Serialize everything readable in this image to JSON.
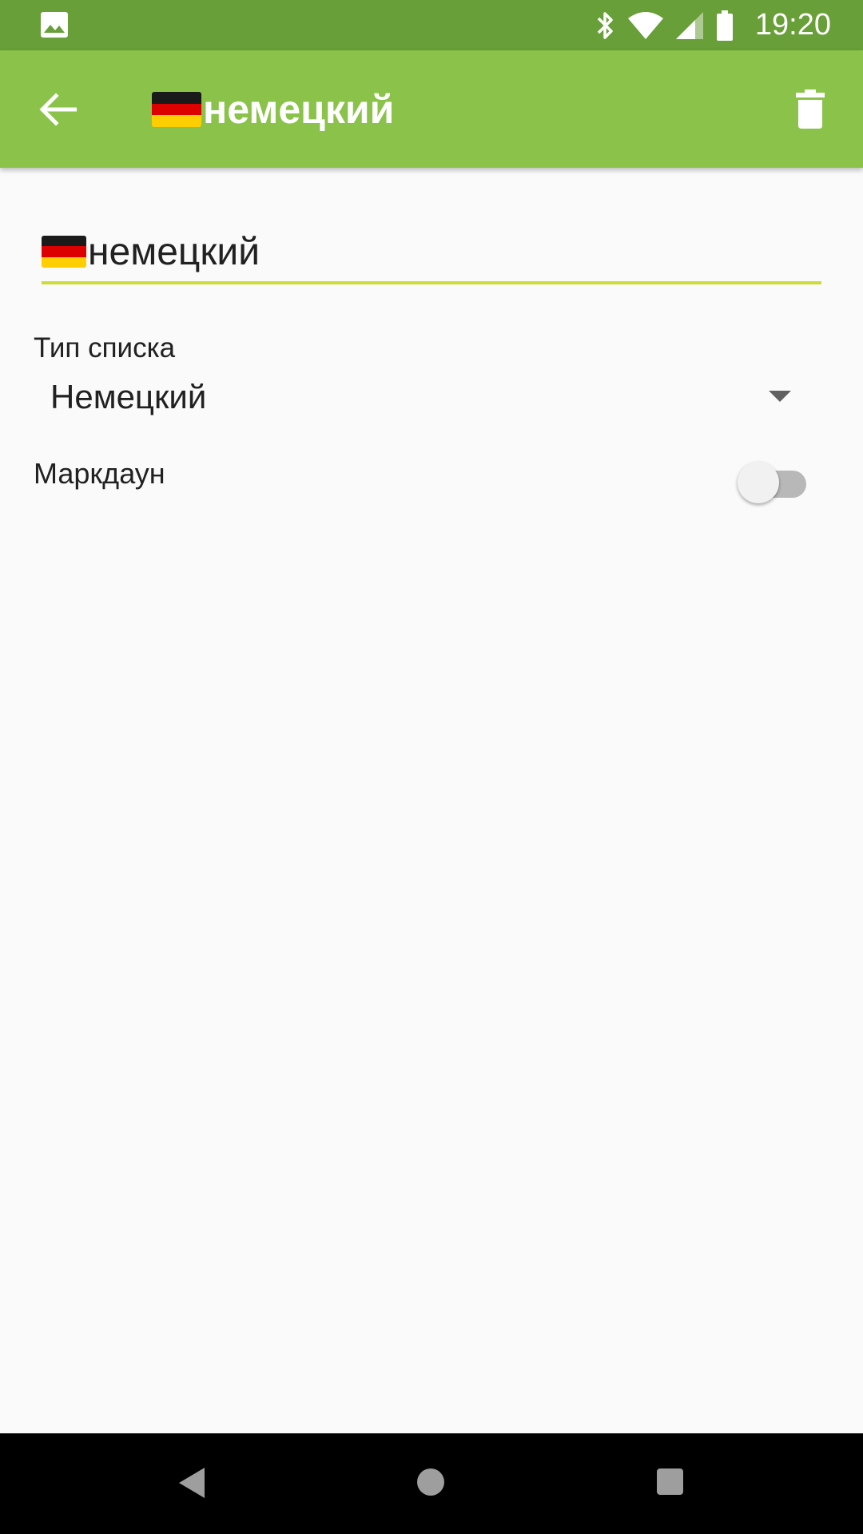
{
  "status_bar": {
    "time": "19:20",
    "icons": [
      "gallery-icon",
      "bluetooth-icon",
      "wifi-icon",
      "signal-icon",
      "battery-icon"
    ]
  },
  "app_bar": {
    "title": "немецкий",
    "back_icon": "arrow-back-icon",
    "delete_icon": "trash-icon",
    "title_flag": "germany-flag-icon"
  },
  "form": {
    "name_value": "немецкий",
    "list_type_label": "Тип списка",
    "list_type_value": "Немецкий",
    "markdown_label": "Маркдаун",
    "markdown_enabled": false
  },
  "nav_bar": {
    "icons": [
      "nav-back-icon",
      "nav-home-icon",
      "nav-recents-icon"
    ]
  },
  "colors": {
    "status_bar": "#689f38",
    "app_bar": "#8bc34a",
    "field_underline": "#cddc39",
    "background": "#fafafa",
    "flag_black": "#1a1a1a",
    "flag_red": "#dd0000",
    "flag_gold": "#ffce00"
  }
}
